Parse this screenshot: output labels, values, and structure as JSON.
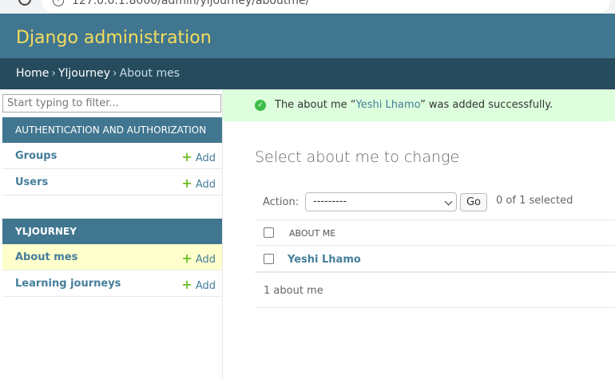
{
  "browser": {
    "url": "127.0.0.1:8000/admin/yljourney/aboutme/"
  },
  "header": {
    "title": "Django administration"
  },
  "breadcrumbs": {
    "home": "Home",
    "app": "Yljourney",
    "current": "About mes",
    "sep": "›"
  },
  "sidebar": {
    "filter_placeholder": "Start typing to filter...",
    "add_label": "Add",
    "modules": [
      {
        "title": "AUTHENTICATION AND AUTHORIZATION",
        "items": [
          "Groups",
          "Users"
        ]
      },
      {
        "title": "YLJOURNEY",
        "items": [
          "About mes",
          "Learning journeys"
        ]
      }
    ]
  },
  "message": {
    "prefix": "The about me “",
    "object": "Yeshi Lhamo",
    "suffix": "” was added successfully."
  },
  "main": {
    "title": "Select about me to change",
    "action_label": "Action:",
    "action_value": "---------",
    "go_label": "Go",
    "selected_counter": "0 of 1 selected",
    "column_header": "ABOUT ME",
    "rows": [
      "Yeshi Lhamo"
    ],
    "paginator": "1 about me"
  }
}
